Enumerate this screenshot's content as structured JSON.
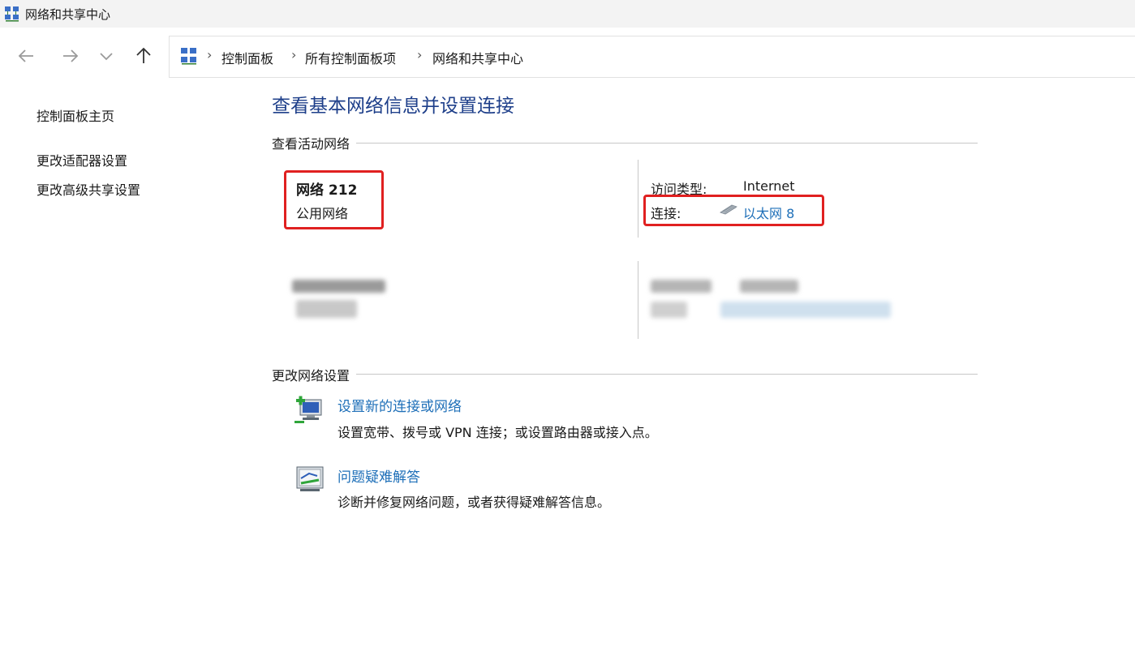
{
  "window": {
    "title": "网络和共享中心",
    "icon": "network-center-icon"
  },
  "nav": {
    "back_icon": "arrow-left-icon",
    "forward_icon": "arrow-right-icon",
    "recent_icon": "chevron-down-icon",
    "up_icon": "arrow-up-icon"
  },
  "breadcrumb": {
    "items": [
      "控制面板",
      "所有控制面板项",
      "网络和共享中心"
    ],
    "separator": "›"
  },
  "sidebar": {
    "home": "控制面板主页",
    "links": [
      "更改适配器设置",
      "更改高级共享设置"
    ]
  },
  "main": {
    "title": "查看基本网络信息并设置连接",
    "active_networks_label": "查看活动网络",
    "network1": {
      "name": "网络 212",
      "category": "公用网络",
      "access_type_label": "访问类型:",
      "access_type_value": "Internet",
      "connection_label": "连接:",
      "connection_value": "以太网 8"
    },
    "change_settings_label": "更改网络设置",
    "tasks": [
      {
        "title": "设置新的连接或网络",
        "desc": "设置宽带、拨号或 VPN 连接；或设置路由器或接入点。",
        "icon": "new-connection-icon"
      },
      {
        "title": "问题疑难解答",
        "desc": "诊断并修复网络问题，或者获得疑难解答信息。",
        "icon": "troubleshoot-icon"
      }
    ]
  },
  "colors": {
    "title_blue": "#1e3f8a",
    "link_blue": "#1e6fb8",
    "highlight_red": "#e02020"
  }
}
